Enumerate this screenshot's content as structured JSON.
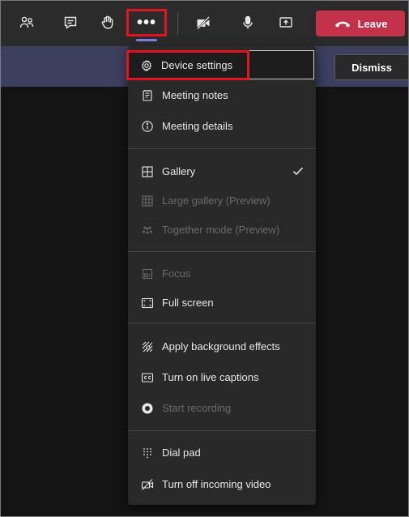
{
  "toolbar": {
    "more_label": "•••",
    "leave_label": "Leave"
  },
  "banner": {
    "dismiss_label": "Dismiss"
  },
  "menu": {
    "items": [
      {
        "label": "Device settings",
        "enabled": true
      },
      {
        "label": "Meeting notes",
        "enabled": true
      },
      {
        "label": "Meeting details",
        "enabled": true
      },
      {
        "label": "Gallery",
        "enabled": true,
        "checked": true
      },
      {
        "label": "Large gallery (Preview)",
        "enabled": false
      },
      {
        "label": "Together mode (Preview)",
        "enabled": false
      },
      {
        "label": "Focus",
        "enabled": false
      },
      {
        "label": "Full screen",
        "enabled": true
      },
      {
        "label": "Apply background effects",
        "enabled": true
      },
      {
        "label": "Turn on live captions",
        "enabled": true
      },
      {
        "label": "Start recording",
        "enabled": false
      },
      {
        "label": "Dial pad",
        "enabled": true
      },
      {
        "label": "Turn off incoming video",
        "enabled": true
      }
    ]
  },
  "colors": {
    "leave": "#c4314b",
    "highlight_annotation": "#e3141e",
    "banner": "#3d3f5e",
    "accent_underline": "#7b83eb"
  }
}
